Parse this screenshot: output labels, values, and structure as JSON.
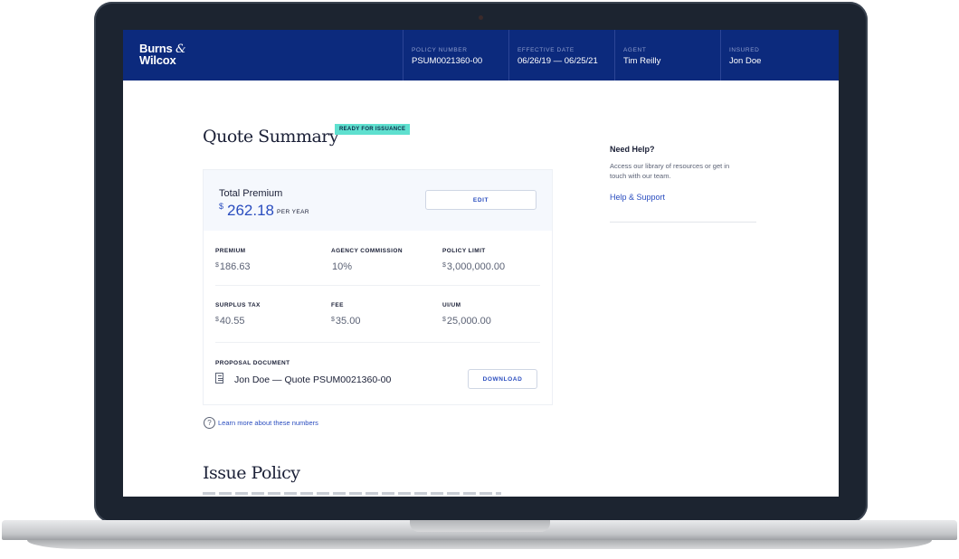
{
  "header": {
    "logo_line1": "Burns",
    "logo_amp": "&",
    "logo_line2": "Wilcox",
    "policy_number": {
      "label": "POLICY NUMBER",
      "value": "PSUM0021360-00"
    },
    "effective_date": {
      "label": "EFFECTIVE DATE",
      "value": "06/26/19 — 06/25/21"
    },
    "agent": {
      "label": "AGENT",
      "value": "Tim Reilly"
    },
    "insured": {
      "label": "INSURED",
      "value": "Jon Doe"
    }
  },
  "quote": {
    "title": "Quote Summary",
    "badge": "READY FOR ISSUANCE",
    "total_label": "Total Premium",
    "currency": "$",
    "total_amount": "262.18",
    "per_year": "PER YEAR",
    "edit_label": "EDIT",
    "rows": [
      [
        {
          "label": "PREMIUM",
          "currency": "$",
          "value": "186.63"
        },
        {
          "label": "AGENCY COMMISSION",
          "currency": "",
          "value": "10%"
        },
        {
          "label": "POLICY LIMIT",
          "currency": "$",
          "value": "3,000,000.00"
        }
      ],
      [
        {
          "label": "SURPLUS TAX",
          "currency": "$",
          "value": "40.55"
        },
        {
          "label": "FEE",
          "currency": "$",
          "value": "35.00"
        },
        {
          "label": "UI/UM",
          "currency": "$",
          "value": "25,000.00"
        }
      ]
    ],
    "document": {
      "label": "PROPOSAL DOCUMENT",
      "icon": "document-icon",
      "name": "Jon Doe — Quote PSUM0021360-00",
      "download_label": "DOWNLOAD"
    },
    "learn_more_icon": "question-circle-icon",
    "learn_more": "Learn more about these numbers"
  },
  "issue": {
    "title": "Issue Policy"
  },
  "help": {
    "title": "Need Help?",
    "text": "Access our library of resources or get in touch with our team.",
    "link": "Help & Support"
  },
  "colors": {
    "header_bg": "#0c2a7d",
    "accent": "#2a4dbf",
    "badge_bg": "#5fe0cf"
  }
}
